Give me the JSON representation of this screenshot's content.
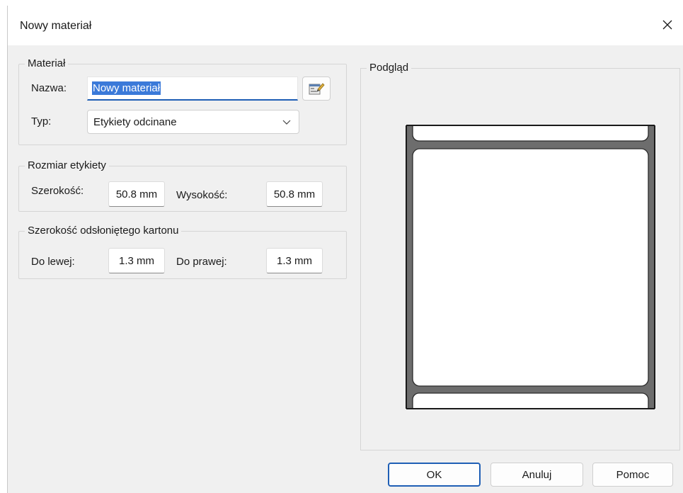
{
  "window": {
    "title": "Nowy materiał"
  },
  "material_group": {
    "legend": "Materiał",
    "name_label": "Nazwa:",
    "name_value": "Nowy materiał",
    "type_label": "Typ:",
    "type_value": "Etykiety odcinane"
  },
  "size_group": {
    "legend": "Rozmiar etykiety",
    "width_label": "Szerokość:",
    "width_value": "50.8 mm",
    "height_label": "Wysokość:",
    "height_value": "50.8 mm"
  },
  "liner_group": {
    "legend": "Szerokość odsłoniętego kartonu",
    "left_label": "Do lewej:",
    "left_value": "1.3 mm",
    "right_label": "Do prawej:",
    "right_value": "1.3 mm"
  },
  "preview": {
    "legend": "Podgląd"
  },
  "buttons": {
    "ok": "OK",
    "cancel": "Anuluj",
    "help": "Pomoc"
  },
  "colors": {
    "accent": "#1f5fb5",
    "selection": "#3b7ad9",
    "liner": "#6d6d6d",
    "label": "#ffffff"
  }
}
